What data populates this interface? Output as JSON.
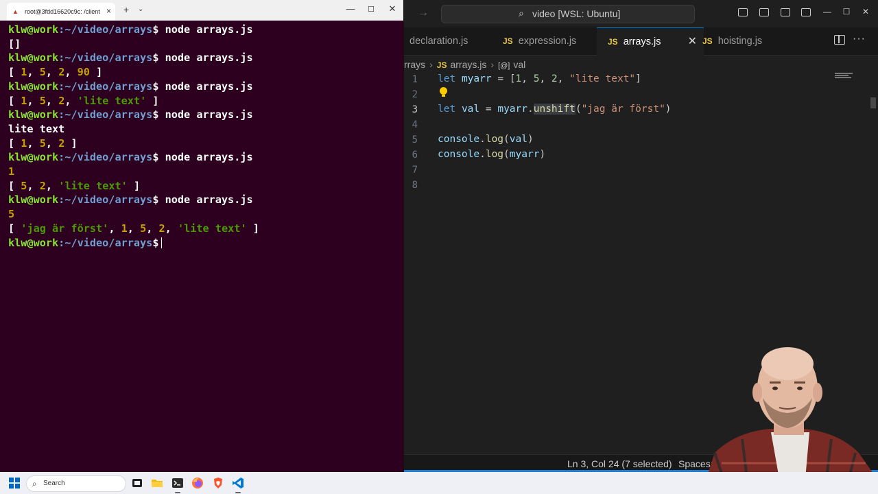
{
  "terminal": {
    "tab_title": "root@3fdd16620c9c: /client",
    "new_tab": "+",
    "dropdown": "⌄",
    "prompt_user": "klw@work",
    "prompt_path": ":~/video/arrays",
    "prompt_symbol": "$",
    "command": " node arrays.js",
    "outputs": {
      "o1": "[]",
      "o2_a": "[ ",
      "o2_n1": "1",
      "o2_n2": "5",
      "o2_n3": "2",
      "o2_n4": "90",
      "o2_end": " ]",
      "o3_n1": "1",
      "o3_n2": "5",
      "o3_n3": "2",
      "o3_s": "'lite text'",
      "o4_text": "lite text",
      "o4_n1": "1",
      "o4_n2": "5",
      "o4_n3": "2",
      "o5_val": "1",
      "o5_n1": "5",
      "o5_n2": "2",
      "o5_s": "'lite text'",
      "o6_val": "5",
      "o6_s1": "'jag är först'",
      "o6_n1": "1",
      "o6_n2": "5",
      "o6_n3": "2",
      "o6_s2": "'lite text'"
    }
  },
  "vscode": {
    "title": "video [WSL: Ubuntu]",
    "tabs": [
      {
        "label": "declaration.js"
      },
      {
        "label": "expression.js"
      },
      {
        "label": "arrays.js"
      },
      {
        "label": "hoisting.js"
      }
    ],
    "tab_badge": "JS",
    "breadcrumb": {
      "folder": "rrays",
      "file": "arrays.js",
      "symbol": "val"
    },
    "line_numbers": [
      "1",
      "2",
      "3",
      "4",
      "5",
      "6",
      "7",
      "8"
    ],
    "code": {
      "l1_kw": "let",
      "l1_var": "myarr",
      "l1_op": " = [",
      "l1_n1": "1",
      "l1_n2": "5",
      "l1_n3": "2",
      "l1_s": "\"lite text\"",
      "l1_end": "]",
      "l3_kw": "let",
      "l3_var": "val",
      "l3_op": " = ",
      "l3_obj": "myarr",
      "l3_dot": ".",
      "l3_fn": "unshift",
      "l3_s": "\"jag är först\"",
      "l5_obj": "console",
      "l5_fn": "log",
      "l5_arg": "val",
      "l6_obj": "console",
      "l6_fn": "log",
      "l6_arg": "myarr"
    },
    "status": {
      "position": "Ln 3, Col 24 (7 selected)",
      "spaces": "Spaces: "
    }
  },
  "taskbar": {
    "search_placeholder": "Search"
  },
  "colors": {
    "terminal_bg": "#2c001e",
    "prompt_user": "#8ae234",
    "prompt_path": "#729fcf",
    "vscode_bg": "#1f1f1f",
    "accent": "#0078d4"
  }
}
